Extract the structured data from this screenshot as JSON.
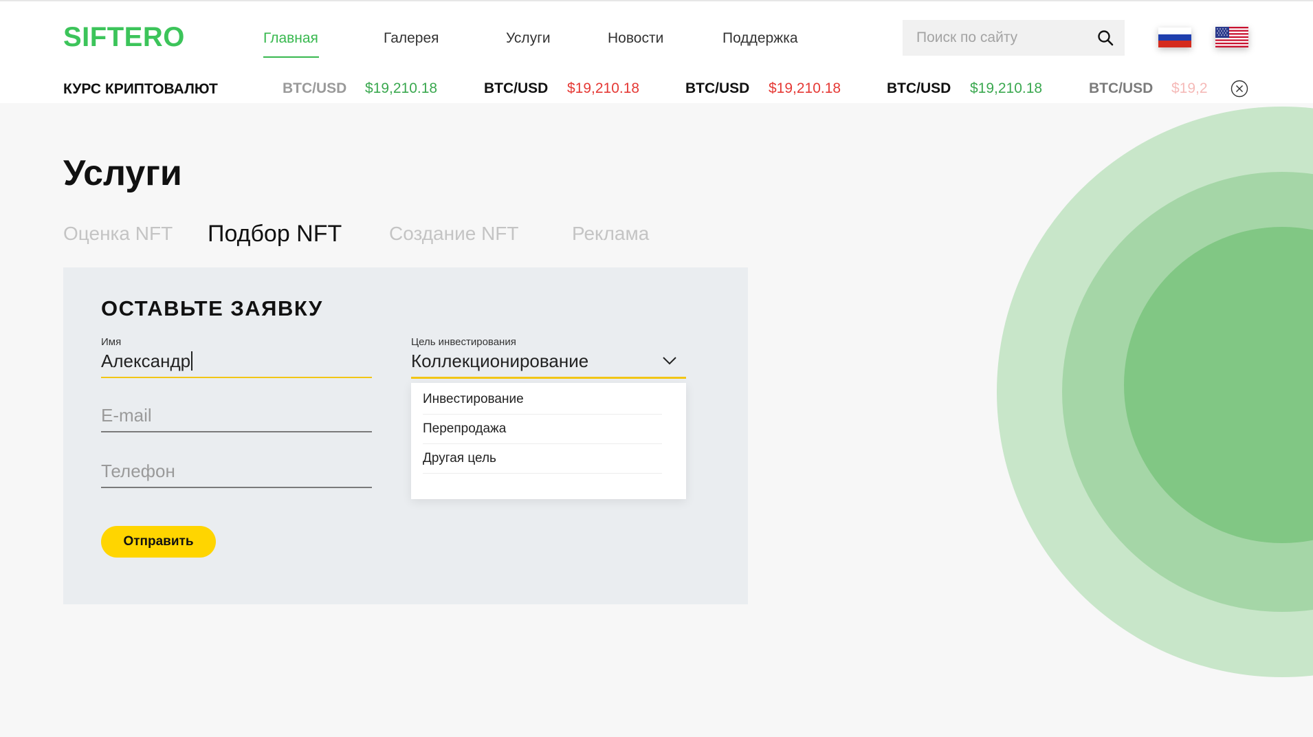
{
  "brand": {
    "logo": "SIFTERO",
    "accent": "#3cc45a"
  },
  "nav": {
    "items": [
      {
        "label": "Главная",
        "active": true
      },
      {
        "label": "Галерея"
      },
      {
        "label": "Услуги"
      },
      {
        "label": "Новости"
      },
      {
        "label": "Поддержка"
      }
    ]
  },
  "search": {
    "placeholder": "Поиск по сайту",
    "icon": "search-icon"
  },
  "languages": [
    {
      "name": "russian-flag-icon"
    },
    {
      "name": "us-flag-icon"
    }
  ],
  "ticker": {
    "title": "КУРС КРИПТОВАЛЮТ",
    "items": [
      {
        "pair": "BTC/USD",
        "value": "$19,210.18",
        "trend": "up"
      },
      {
        "pair": "BTC/USD",
        "value": "$19,210.18",
        "trend": "down"
      },
      {
        "pair": "BTC/USD",
        "value": "$19,210.18",
        "trend": "down"
      },
      {
        "pair": "BTC/USD",
        "value": "$19,210.18",
        "trend": "up"
      },
      {
        "pair": "BTC/USD",
        "value": "$19,2"
      }
    ],
    "close_icon": "close-icon"
  },
  "page": {
    "title": "Услуги"
  },
  "tabs": [
    {
      "label": "Оценка NFT"
    },
    {
      "label": "Подбор NFT",
      "active": true
    },
    {
      "label": "Создание NFT"
    },
    {
      "label": "Реклама"
    }
  ],
  "form": {
    "title": "ОСТАВЬТЕ ЗАЯВКУ",
    "name": {
      "label": "Имя",
      "value": "Александр"
    },
    "email": {
      "placeholder": "E-mail"
    },
    "phone": {
      "placeholder": "Телефон"
    },
    "goal": {
      "label": "Цель инвестирования",
      "value": "Коллекционирование",
      "options": [
        "Инвестирование",
        "Перепродажа",
        "Другая цель"
      ]
    },
    "submit_label": "Отправить"
  },
  "colors": {
    "up": "#3aa84f",
    "down": "#e53935",
    "button": "#ffd500",
    "underline": "#f2c615"
  }
}
